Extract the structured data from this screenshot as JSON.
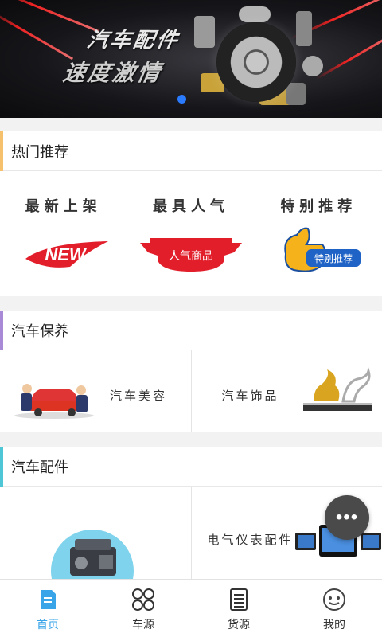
{
  "banner": {
    "headline": "汽车配件",
    "slogan": "速度激情",
    "active_slide": 1
  },
  "sections": {
    "hot": {
      "title": "热门推荐",
      "accent": "#f5c16c",
      "items": [
        {
          "label": "最新上架",
          "badge": "NEW"
        },
        {
          "label": "最具人气",
          "badge": "人气商品"
        },
        {
          "label": "特别推荐",
          "badge": "特别推荐"
        }
      ]
    },
    "maintenance": {
      "title": "汽车保养",
      "accent": "#a98ad6",
      "items": [
        {
          "label": "汽车美容"
        },
        {
          "label": "汽车饰品"
        }
      ]
    },
    "parts": {
      "title": "汽车配件",
      "accent": "#4fc6d6",
      "items": [
        {
          "label": ""
        },
        {
          "label": "电气仪表配件"
        }
      ]
    }
  },
  "fab": {
    "icon": "more-icon"
  },
  "tabs": [
    {
      "label": "首页",
      "icon": "home-doc-icon",
      "active": true
    },
    {
      "label": "车源",
      "icon": "grid-icon",
      "active": false
    },
    {
      "label": "货源",
      "icon": "list-doc-icon",
      "active": false
    },
    {
      "label": "我的",
      "icon": "face-icon",
      "active": false
    }
  ],
  "colors": {
    "tab_active": "#39a4e8",
    "badge_red": "#e21e2b",
    "dot": "#2b7bff"
  }
}
